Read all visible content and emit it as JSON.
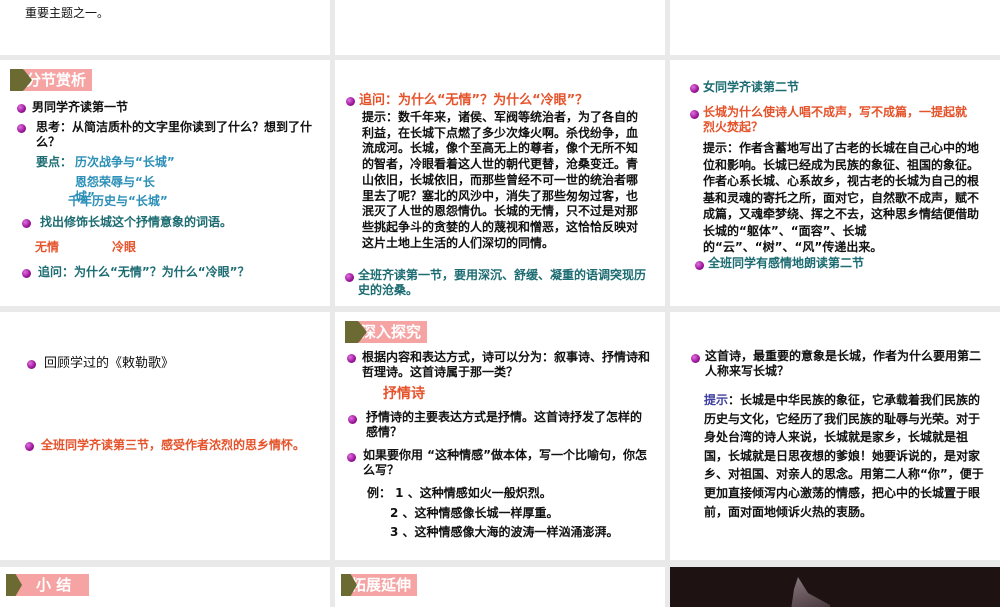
{
  "slides": {
    "r1c1": {
      "text": "重要主题之一。"
    },
    "a": {
      "badge": "分节赏析",
      "l1": "男同学齐读第一节",
      "l2": "思考：从简洁质朴的文字里你读到了什么？想到了什么？",
      "key_label": "要点：",
      "k1": "历次战争与“长城”",
      "k2a": "恩怨荣辱与“长",
      "k2b": "城”",
      "k3": "千年历史与“长城”",
      "l3": "找出修饰长城这个抒情意象的词语。",
      "w1": "无情",
      "w2": "冷眼",
      "l4": "追问：为什么“无情”？为什么“冷眼”？"
    },
    "b": {
      "q": "追问：为什么“无情”？为什么“冷眼”？",
      "hint": "提示：数千年来，诸侯、军阀等统治者，为了各自的利益，在长城下点燃了多少次烽火啊。杀伐纷争，血流成河。长城，像个至高无上的尊者，像个无所不知的智者，冷眼看着这人世的朝代更替，沧桑变迁。青山依旧，长城依旧，而那些曾经不可一世的统治者哪里去了呢？塞北的风沙中，消失了那些匆匆过客，也泯灭了人世的恩怨情仇。长城的无情，只不过是对那些挑起争斗的贪婪的人的蔑视和憎恶，这恰恰反映对这片土地上生活的人们深切的同情。",
      "l2": "全班齐读第一节，要用深沉、舒缓、凝重的语调突现历史的沧桑。"
    },
    "c": {
      "l1": "女同学齐读第二节",
      "q": "长城为什么使诗人唱不成声，写不成篇，一提起就烈火焚起？",
      "hint": "提示：作者含蓄地写出了古老的长城在自己心中的地位和影响。长城已经成为民族的象征、祖国的象征。作者心系长城、心系故乡，视古老的长城为自己的根基和灵魂的寄托之所，面对它，自然歌不成声，赋不成篇，又魂牵梦绕、挥之不去，这种思乡情结便借助长城的“躯体”、“面容”、长城的“云”、“树”、“风”传递出来。",
      "l2": "全班同学有感情地朗读第二节"
    },
    "d": {
      "l1": "回顾学过的《敕勒歌》",
      "l2": "全班同学齐读第三节，感受作者浓烈的思乡情怀。"
    },
    "e": {
      "badge": "深入探究",
      "l1": "根据内容和表达方式，诗可以分为：叙事诗、抒情诗和哲理诗。这首诗属于那一类？",
      "ans": "抒情诗",
      "l2": "抒情诗的主要表达方式是抒情。这首诗抒发了怎样的感情？",
      "l3": "如果要你用 “这种情感”做本体，写一个比喻句，你怎么写？",
      "ex1": "例： 1 、这种情感如火一般炽烈。",
      "ex2": "2 、这种情感像长城一样厚重。",
      "ex3": "3 、这种情感像大海的波涛一样汹涌澎湃。"
    },
    "f": {
      "l1": "这首诗，最重要的意象是长城，作者为什么要用第二人称来写长城？",
      "hint_label": "提示",
      "hint": "：长城是中华民族的象征，它承载着我们民族的历史与文化，它经历了我们民族的耻辱与光荣。对于身处台湾的诗人来说，长城就是家乡，长城就是祖国，长城就是日思夜想的爹娘！她要诉说的，是对家乡、对祖国、对亲人的思念。用第二人称“你”，便于更加直接倾泻内心激荡的情感，把心中的长城置于眼前，面对面地倾诉火热的衷肠。"
    },
    "g": {
      "badge": "小 结"
    },
    "h": {
      "badge": "拓展延伸"
    }
  },
  "colors": {
    "teal": "#1c6c72",
    "blue": "#2b8fb8",
    "red": "#e5532b",
    "bullet": "#9a1498",
    "badge_pink": "#f5a3a3",
    "badge_olive": "#6b6a33"
  }
}
